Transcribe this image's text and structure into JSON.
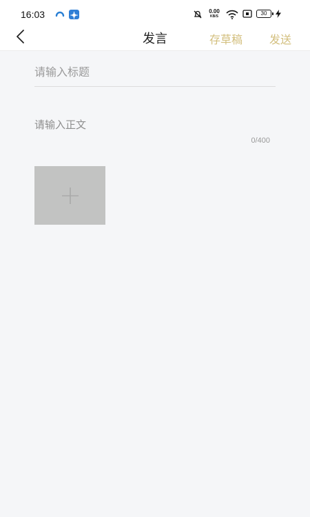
{
  "status_bar": {
    "time": "16:03",
    "net_speed": "0.00",
    "net_speed_unit": "KB/S",
    "battery": "30"
  },
  "nav": {
    "title": "发言",
    "draft_label": "存草稿",
    "send_label": "发送"
  },
  "form": {
    "title_placeholder": "请输入标题",
    "body_placeholder": "请输入正文",
    "char_count": "0/400"
  },
  "colors": {
    "accent": "#d3bf7e",
    "background": "#f5f6f8",
    "add_image_tile": "#c2c3c2"
  },
  "icons": {
    "back": "back-arrow-icon",
    "add_image": "plus-icon"
  }
}
